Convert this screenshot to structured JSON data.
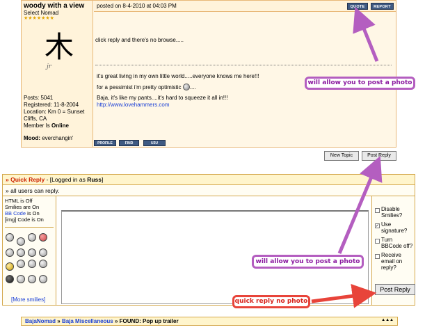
{
  "post": {
    "author": {
      "name": "woody with a view",
      "title": "Select Nomad",
      "stars": "★★★★★★★",
      "avatar_glyph": "木",
      "avatar_signature": "jr",
      "stats": {
        "posts": "Posts: 5041",
        "registered": "Registered: 11-8-2004",
        "location": "Location: Km 0 = Sunset Cliffs, CA",
        "member_is": "Member Is",
        "status": "Online"
      },
      "mood_label": "Mood:",
      "mood": "everchangin'"
    },
    "posted": "posted on 8-4-2010 at 04:03 PM",
    "header_buttons": {
      "quote": "QUOTE",
      "report": "REPORT"
    },
    "body": "click reply and there's no browse.....",
    "signature": {
      "line1": "it's great living in my own little world.....everyone knows me here!!!",
      "line2": "for a pessimist i'm pretty optimistic",
      "line2_end": "....",
      "line3": "Baja, it's like my pants....it's hard to squeeze it all in!!!",
      "link": "http://www.lovehammers.com"
    },
    "footer_buttons": {
      "profile": "PROFILE",
      "find": "FIND",
      "u2u": "U2U"
    }
  },
  "actions": {
    "new_topic": "New Topic",
    "post_reply": "Post Reply"
  },
  "quick_reply": {
    "title": "» Quick Reply",
    "logged_prefix": " - [Logged in as ",
    "user": "Russ",
    "logged_suffix": "]",
    "subheader": "» all users can reply.",
    "status": {
      "html": "HTML is Off",
      "smilies": "Smilies are On",
      "bbcode_link": "BB Code",
      "bbcode_rest": " is On",
      "img": "[img] Code is On"
    },
    "more_smilies": "[More smilies]",
    "options": [
      {
        "label": "Disable Smilies?",
        "checked": false
      },
      {
        "label": "Use signature?",
        "checked": true
      },
      {
        "label": "Turn BBCode off?",
        "checked": false
      },
      {
        "label": "Receive email on reply?",
        "checked": false
      }
    ],
    "submit": "Post Reply"
  },
  "breadcrumb": {
    "items": [
      "BajaNomad",
      "Baja Miscellaneous"
    ],
    "separator": "»",
    "current": "FOUND: Pop up trailer",
    "nav": "▲▲▲"
  },
  "annotations": {
    "top": "will allow you to post a photo",
    "middle": "will allow you to post a photo",
    "bottom": "quick reply no photo",
    "purple": "#b45ec0",
    "red": "#e8443a"
  }
}
